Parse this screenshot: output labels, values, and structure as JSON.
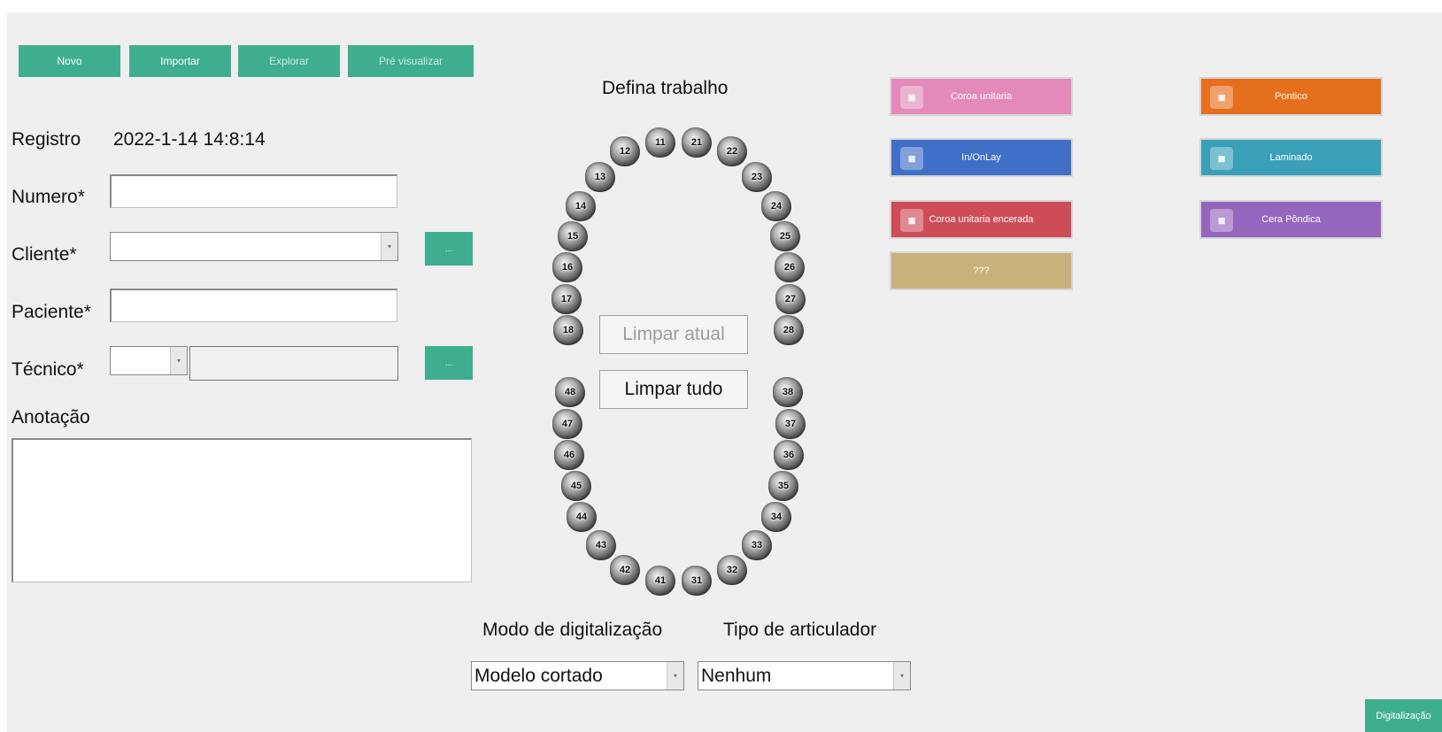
{
  "toolbar": {
    "novo": "Novo",
    "importar": "Importar",
    "explorar": "Explorar",
    "pre_visualizar": "Pré visualizar"
  },
  "form": {
    "registro_label": "Registro",
    "registro_value": "2022-1-14 14:8:14",
    "numero_label": "Numero*",
    "numero_value": "",
    "cliente_label": "Cliente*",
    "cliente_value": "",
    "cliente_button": "...",
    "paciente_label": "Paciente*",
    "paciente_value": "",
    "tecnico_label": "Técnico*",
    "tecnico_code": "",
    "tecnico_value": "",
    "tecnico_button": "...",
    "anotacao_label": "Anotação",
    "anotacao_value": ""
  },
  "chart": {
    "title": "Defina trabalho",
    "limpar_atual": "Limpar atual",
    "limpar_tudo": "Limpar tudo",
    "teeth": [
      "11",
      "12",
      "13",
      "14",
      "15",
      "16",
      "17",
      "18",
      "21",
      "22",
      "23",
      "24",
      "25",
      "26",
      "27",
      "28",
      "31",
      "32",
      "33",
      "34",
      "35",
      "36",
      "37",
      "38",
      "41",
      "42",
      "43",
      "44",
      "45",
      "46",
      "47",
      "48"
    ]
  },
  "work_types": [
    {
      "label": "Coroa unitaria",
      "color": "#e48abb",
      "icon": "crown-icon"
    },
    {
      "label": "Pontico",
      "color": "#e56f1d",
      "icon": "pontic-icon"
    },
    {
      "label": "In/OnLay",
      "color": "#3f6fc6",
      "icon": "inlay-icon"
    },
    {
      "label": "Laminado",
      "color": "#3a9fb8",
      "icon": "veneer-icon"
    },
    {
      "label": "Coroa unitaria encerada",
      "color": "#cd4c58",
      "icon": "wax-crown-icon"
    },
    {
      "label": "Cera Pôndica",
      "color": "#9566be",
      "icon": "wax-pontic-icon"
    },
    {
      "label": "???",
      "color": "#c9b279",
      "icon": ""
    }
  ],
  "scan": {
    "modo_label": "Modo de digitalização",
    "modo_value": "Modelo cortado",
    "articulador_label": "Tipo de articulador",
    "articulador_value": "Nenhum"
  },
  "footer": {
    "digitalizacao": "Digitalização"
  }
}
